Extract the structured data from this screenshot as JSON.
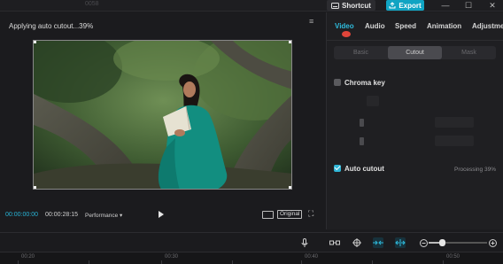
{
  "topbar": {
    "ghost_text": "0058",
    "shortcut_label": "Shortcut",
    "export_label": "Export",
    "window_controls": [
      "—",
      "☐",
      "✕"
    ]
  },
  "player": {
    "status_text": "Applying auto cutout...39%",
    "more_icon": "more-icon",
    "current_time": "00:00:00:00",
    "duration": "00:00:28:15",
    "performance_label": "Performance ▾",
    "original_label": "Original"
  },
  "panel": {
    "tabs": [
      {
        "label": "Video",
        "active": true
      },
      {
        "label": "Audio",
        "active": false
      },
      {
        "label": "Speed",
        "active": false
      },
      {
        "label": "Animation",
        "active": false
      },
      {
        "label": "Adjustme",
        "active": false
      }
    ],
    "subtabs": [
      {
        "label": "Basic",
        "active": false
      },
      {
        "label": "Cutout",
        "active": true
      },
      {
        "label": "Mask",
        "active": false
      }
    ],
    "chroma_key": {
      "label": "Chroma key",
      "checked": false
    },
    "auto_cutout": {
      "label": "Auto cutout",
      "checked": true,
      "status": "Processing 39%"
    }
  },
  "timeline": {
    "ruler": [
      "00:20",
      "00:30",
      "00:40",
      "00:50"
    ],
    "zoom_level": 0.2
  },
  "colors": {
    "accent": "#2fbbdc",
    "export": "#10a4c3"
  }
}
